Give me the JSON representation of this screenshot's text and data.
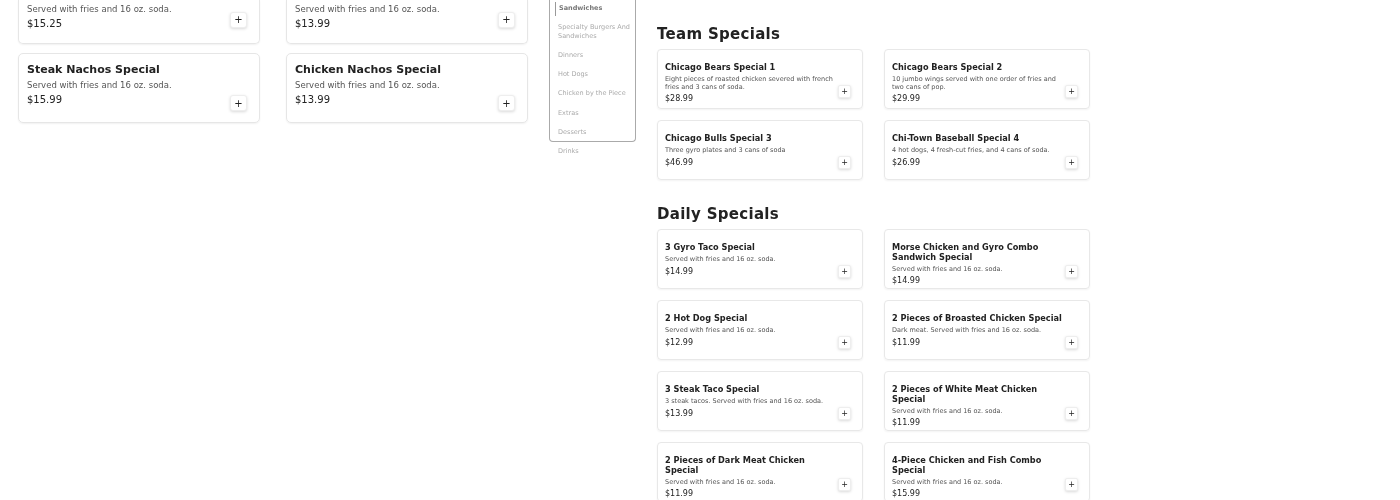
{
  "left_menu": {
    "cards": [
      {
        "description": "Served with fries and 16 oz. soda.",
        "price": "$15.25"
      },
      {
        "description": "Served with fries and 16 oz. soda.",
        "price": "$13.99"
      },
      {
        "name": "Steak Nachos Special",
        "description": "Served with fries and 16 oz. soda.",
        "price": "$15.99"
      },
      {
        "name": "Chicken Nachos Special",
        "description": "Served with fries and 16 oz. soda.",
        "price": "$13.99"
      }
    ],
    "add_label": "+"
  },
  "sidebar": {
    "items": [
      {
        "label": "Sandwiches",
        "selected": true
      },
      {
        "label": "Specialty Burgers And Sandwiches",
        "selected": false
      },
      {
        "label": "Dinners",
        "selected": false
      },
      {
        "label": "Hot Dogs",
        "selected": false
      },
      {
        "label": "Chicken by the Piece",
        "selected": false
      },
      {
        "label": "Extras",
        "selected": false
      },
      {
        "label": "Desserts",
        "selected": false
      },
      {
        "label": "Drinks",
        "selected": false
      }
    ]
  },
  "sections": [
    {
      "title": "Team Specials",
      "items": [
        {
          "name": "Chicago Bears Special 1",
          "description": "Eight pieces of roasted chicken severed with french fries and 3 cans of soda.",
          "price": "$28.99"
        },
        {
          "name": "Chicago Bears Special 2",
          "description": "10 jumbo wings served with one order of fries and two cans of pop.",
          "price": "$29.99"
        },
        {
          "name": "Chicago Bulls Special 3",
          "description": "Three gyro plates and 3 cans of soda",
          "price": "$46.99"
        },
        {
          "name": "Chi-Town Baseball Special 4",
          "description": "4 hot dogs, 4 fresh-cut fries, and 4 cans of soda.",
          "price": "$26.99"
        }
      ]
    },
    {
      "title": "Daily Specials",
      "items": [
        {
          "name": "3 Gyro Taco Special",
          "description": "Served with fries and 16 oz. soda.",
          "price": "$14.99"
        },
        {
          "name": "Morse Chicken and Gyro Combo Sandwich Special",
          "description": "Served with fries and 16 oz. soda.",
          "price": "$14.99"
        },
        {
          "name": "2 Hot Dog Special",
          "description": "Served with fries and 16 oz. soda.",
          "price": "$12.99"
        },
        {
          "name": "2 Pieces of Broasted Chicken Special",
          "description": "Dark meat. Served with fries and 16 oz. soda.",
          "price": "$11.99"
        },
        {
          "name": "3 Steak Taco Special",
          "description": "3 steak tacos. Served with fries and 16 oz. soda.",
          "price": "$13.99"
        },
        {
          "name": "2 Pieces of White Meat Chicken Special",
          "description": "Served with fries and 16 oz. soda.",
          "price": "$11.99"
        },
        {
          "name": "2 Pieces of Dark Meat Chicken Special",
          "description": "Served with fries and 16 oz. soda.",
          "price": "$11.99"
        },
        {
          "name": "4-Piece Chicken and Fish Combo Special",
          "description": "Served with fries and 16 oz. soda.",
          "price": "$15.99"
        }
      ]
    }
  ]
}
